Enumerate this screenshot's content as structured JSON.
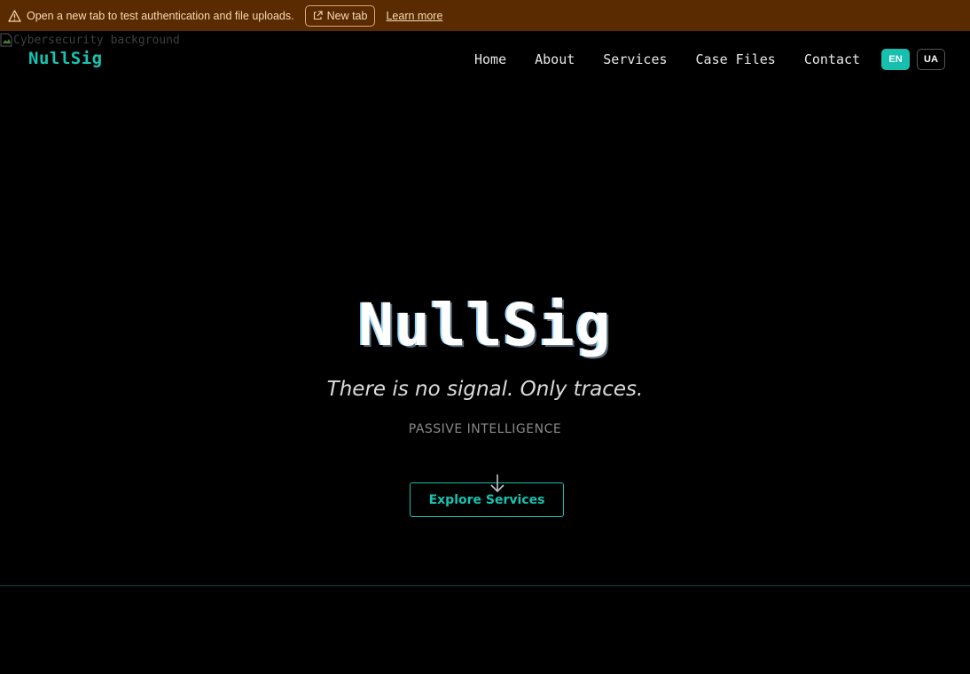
{
  "banner": {
    "message": "Open a new tab to test authentication and file uploads.",
    "new_tab_label": "New tab",
    "learn_more_label": "Learn more",
    "icon": "warning-icon"
  },
  "background_image": {
    "alt": "Cybersecurity background"
  },
  "nav": {
    "brand": "NullSig",
    "items": [
      "Home",
      "About",
      "Services",
      "Case Files",
      "Contact"
    ],
    "languages": {
      "en": "EN",
      "ua": "UA",
      "active": "EN"
    }
  },
  "hero": {
    "title": "NullSig",
    "tagline": "There is no signal. Only traces.",
    "subtitle": "PASSIVE INTELLIGENCE",
    "cta_label": "Explore Services",
    "scroll_icon": "arrow-down-icon"
  },
  "colors": {
    "accent": "#17c3b2",
    "banner_bg": "#5a2a00",
    "page_bg": "#000000"
  }
}
